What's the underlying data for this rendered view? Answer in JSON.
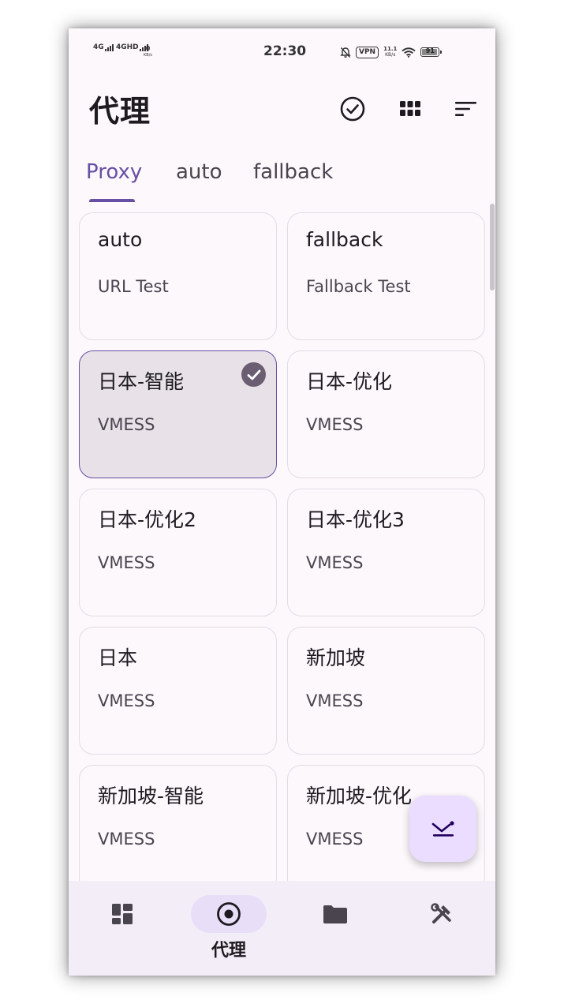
{
  "status_bar": {
    "signal1": "4G",
    "signal2": "4GHD",
    "speed_value": "0",
    "speed_unit": "KB/s",
    "time": "22:30",
    "vpn": "VPN",
    "net_value": "11.1",
    "net_unit": "KB/s",
    "battery": "91"
  },
  "header": {
    "title": "代理",
    "actions": [
      "check-circle-icon",
      "grid-view-icon",
      "sort-icon"
    ]
  },
  "tabs": [
    {
      "label": "Proxy",
      "active": true
    },
    {
      "label": "auto",
      "active": false
    },
    {
      "label": "fallback",
      "active": false
    }
  ],
  "proxies": [
    {
      "name": "auto",
      "type": "URL Test",
      "selected": false
    },
    {
      "name": "fallback",
      "type": "Fallback Test",
      "selected": false
    },
    {
      "name": "日本-智能",
      "type": "VMESS",
      "selected": true
    },
    {
      "name": "日本-优化",
      "type": "VMESS",
      "selected": false
    },
    {
      "name": "日本-优化2",
      "type": "VMESS",
      "selected": false
    },
    {
      "name": "日本-优化3",
      "type": "VMESS",
      "selected": false
    },
    {
      "name": "日本",
      "type": "VMESS",
      "selected": false
    },
    {
      "name": "新加坡",
      "type": "VMESS",
      "selected": false
    },
    {
      "name": "新加坡-智能",
      "type": "VMESS",
      "selected": false
    },
    {
      "name": "新加坡-优化",
      "type": "VMESS",
      "selected": false
    }
  ],
  "fab": {
    "icon": "collapse-chevron-icon"
  },
  "bottom_nav": [
    {
      "icon": "dashboard-icon",
      "label": "",
      "active": false
    },
    {
      "icon": "proxy-radio-icon",
      "label": "代理",
      "active": true
    },
    {
      "icon": "folder-icon",
      "label": "",
      "active": false
    },
    {
      "icon": "tools-icon",
      "label": "",
      "active": false
    }
  ],
  "colors": {
    "primary": "#6750a4",
    "surface": "#fdf8fc",
    "selected_card": "#e8e1e7",
    "fab": "#eaddff",
    "nav_bar": "#f3edf7"
  }
}
